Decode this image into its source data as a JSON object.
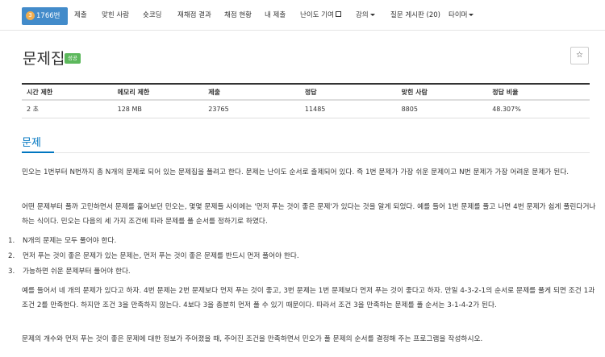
{
  "nav": {
    "brand_number": "3",
    "brand_label": "1766번",
    "items": [
      {
        "label": "제출"
      },
      {
        "label": "맞힌 사람"
      },
      {
        "label": "숏코딩"
      },
      {
        "label": "재채점 결과"
      },
      {
        "label": "채점 현황"
      },
      {
        "label": "내 제출"
      },
      {
        "label": "난이도 기여"
      },
      {
        "label": "강의"
      },
      {
        "label": "질문 게시판 (20)"
      },
      {
        "label": "타이머"
      }
    ]
  },
  "title": "문제집",
  "status_badge": "성공",
  "star_label": "☆",
  "table": {
    "headers": [
      "시간 제한",
      "메모리 제한",
      "제출",
      "정답",
      "맞힌 사람",
      "정답 비율"
    ],
    "row": [
      "2 초",
      "128 MB",
      "23765",
      "11485",
      "8805",
      "48.307%"
    ]
  },
  "section_title": "문제",
  "paragraphs": {
    "p1": "민오는 1번부터 N번까지 총 N개의 문제로 되어 있는 문제집을 풀려고 한다. 문제는 난이도 순서로 출제되어 있다. 즉 1번 문제가 가장 쉬운 문제이고 N번 문제가 가장 어려운 문제가 된다.",
    "p2": "어떤 문제부터 풀까 고민하면서 문제를 훑어보던 민오는, 몇몇 문제들 사이에는 '먼저 푸는 것이 좋은 문제'가 있다는 것을 알게 되었다. 예를 들어 1번 문제를 풀고 나면 4번 문제가 쉽게 풀린다거나 하는 식이다. 민오는 다음의 세 가지 조건에 따라 문제를 풀 순서를 정하기로 하였다.",
    "p3": "예를 들어서 네 개의 문제가 있다고 하자. 4번 문제는 2번 문제보다 먼저 푸는 것이 좋고, 3번 문제는 1번 문제보다 먼저 푸는 것이 좋다고 하자. 만일 4-3-2-1의 순서로 문제를 풀게 되면 조건 1과 조건 2를 만족한다. 하지만 조건 3을 만족하지 않는다. 4보다 3을 충분히 먼저 풀 수 있기 때문이다. 따라서 조건 3을 만족하는 문제를 풀 순서는 3-1-4-2가 된다.",
    "p4": "문제의 개수와 먼저 푸는 것이 좋은 문제에 대한 정보가 주어졌을 때, 주어진 조건을 만족하면서 민오가 풀 문제의 순서를 결정해 주는 프로그램을 작성하시오."
  },
  "conditions": [
    {
      "num": "1.",
      "text": "N개의 문제는 모두 풀어야 한다."
    },
    {
      "num": "2.",
      "text": "먼저 푸는 것이 좋은 문제가 있는 문제는, 먼저 푸는 것이 좋은 문제를 반드시 먼저 풀어야 한다."
    },
    {
      "num": "3.",
      "text": "가능하면 쉬운 문제부터 풀어야 한다."
    }
  ]
}
